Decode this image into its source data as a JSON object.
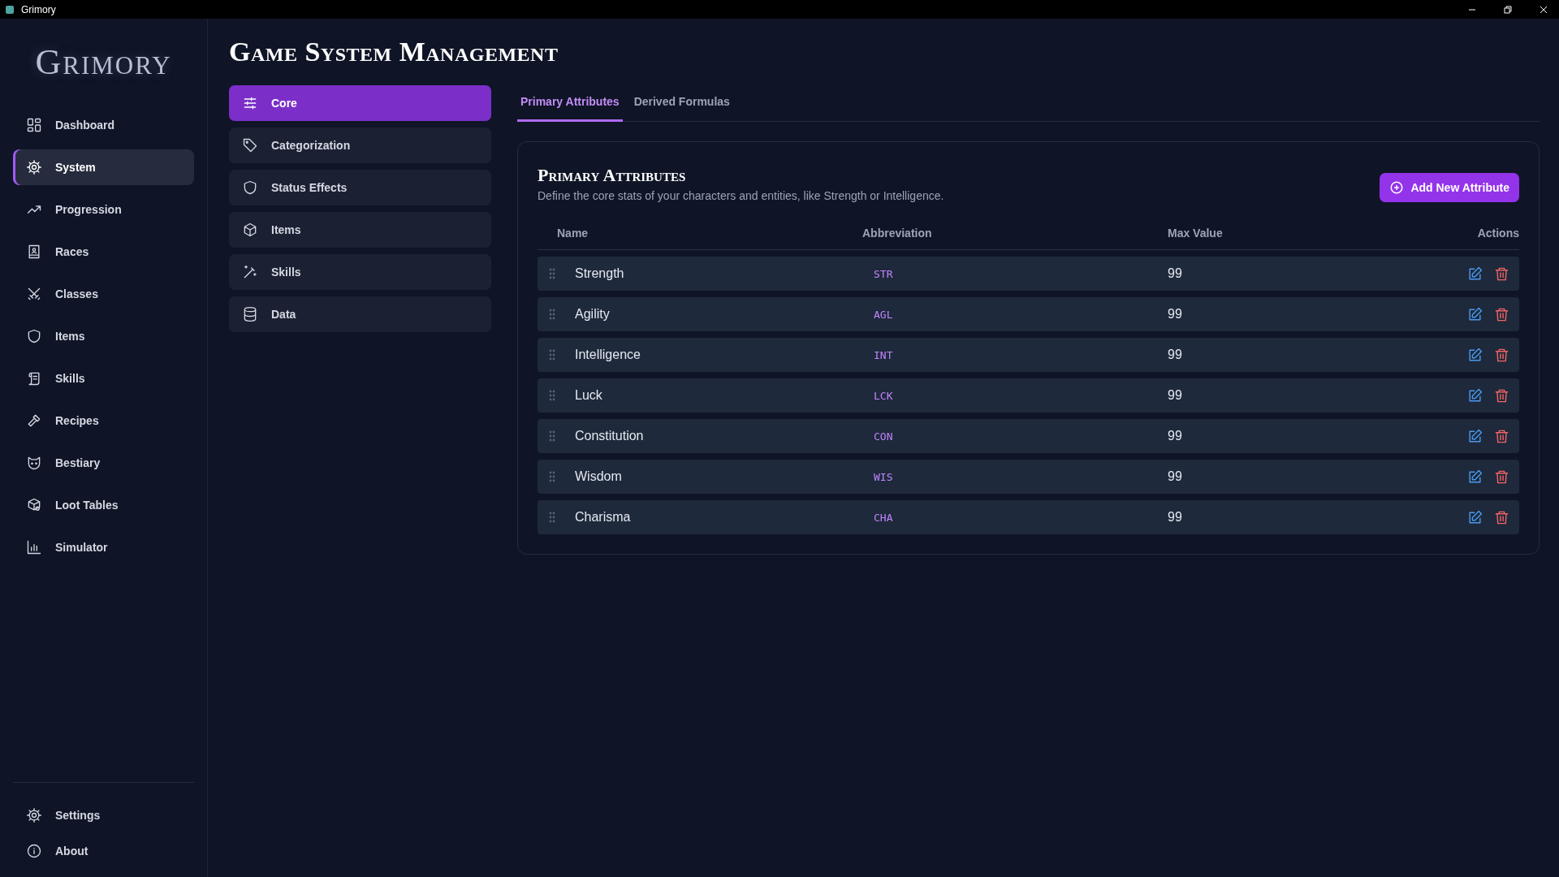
{
  "window": {
    "title": "Grimory"
  },
  "sidebar": {
    "logo": "Grimory",
    "items": [
      {
        "label": "Dashboard",
        "selected": false
      },
      {
        "label": "System",
        "selected": true
      },
      {
        "label": "Progression",
        "selected": false
      },
      {
        "label": "Races",
        "selected": false
      },
      {
        "label": "Classes",
        "selected": false
      },
      {
        "label": "Items",
        "selected": false
      },
      {
        "label": "Skills",
        "selected": false
      },
      {
        "label": "Recipes",
        "selected": false
      },
      {
        "label": "Bestiary",
        "selected": false
      },
      {
        "label": "Loot Tables",
        "selected": false
      },
      {
        "label": "Simulator",
        "selected": false
      }
    ],
    "footer_items": [
      {
        "label": "Settings"
      },
      {
        "label": "About"
      }
    ]
  },
  "page_title": "Game System Management",
  "sections": [
    {
      "label": "Core",
      "selected": true
    },
    {
      "label": "Categorization",
      "selected": false
    },
    {
      "label": "Status Effects",
      "selected": false
    },
    {
      "label": "Items",
      "selected": false
    },
    {
      "label": "Skills",
      "selected": false
    },
    {
      "label": "Data",
      "selected": false
    }
  ],
  "tabs": [
    {
      "label": "Primary Attributes",
      "selected": true
    },
    {
      "label": "Derived Formulas",
      "selected": false
    }
  ],
  "panel": {
    "title": "Primary Attributes",
    "description": "Define the core stats of your characters and entities, like Strength or Intelligence.",
    "add_button": "Add New Attribute",
    "columns": [
      "Name",
      "Abbreviation",
      "Max Value",
      "Actions"
    ],
    "rows": [
      {
        "name": "Strength",
        "abbreviation": "STR",
        "max_value": "99"
      },
      {
        "name": "Agility",
        "abbreviation": "AGL",
        "max_value": "99"
      },
      {
        "name": "Intelligence",
        "abbreviation": "INT",
        "max_value": "99"
      },
      {
        "name": "Luck",
        "abbreviation": "LCK",
        "max_value": "99"
      },
      {
        "name": "Constitution",
        "abbreviation": "CON",
        "max_value": "99"
      },
      {
        "name": "Wisdom",
        "abbreviation": "WIS",
        "max_value": "99"
      },
      {
        "name": "Charisma",
        "abbreviation": "CHA",
        "max_value": "99"
      }
    ]
  }
}
